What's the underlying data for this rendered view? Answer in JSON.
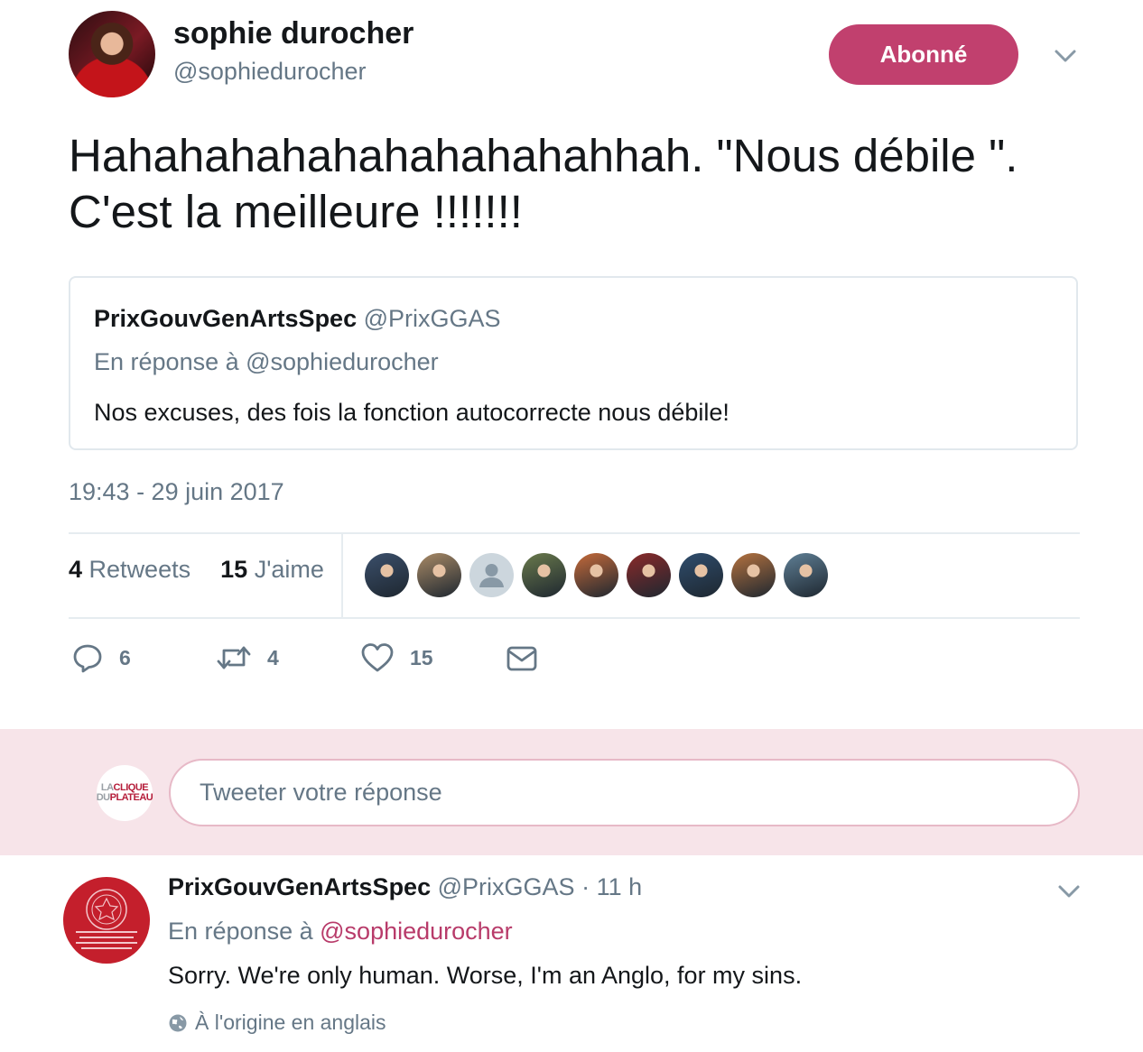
{
  "tweet": {
    "author_name": "sophie durocher",
    "author_handle": "@sophiedurocher",
    "follow_label": "Abonné",
    "text": "Hahahahahahahahahahahhah. \"Nous débile \". C'est la meilleure !!!!!!!",
    "timestamp": "19:43 - 29 juin 2017",
    "retweets_count": "4",
    "retweets_label": "Retweets",
    "likes_count": "15",
    "likes_label": "J'aime",
    "actions": {
      "reply_count": "6",
      "retweet_count": "4",
      "like_count": "15"
    }
  },
  "quoted": {
    "name": "PrixGouvGenArtsSpec",
    "handle": "@PrixGGAS",
    "reply_to": "En réponse à @sophiedurocher",
    "text": "Nos excuses, des fois la fonction autocorrecte nous débile!"
  },
  "likers": [
    {
      "icon": "avatar-1",
      "color": "#3b4f6b"
    },
    {
      "icon": "avatar-2",
      "color": "#a98a66"
    },
    {
      "icon": "avatar-default",
      "color": "#ccd6dd"
    },
    {
      "icon": "avatar-4",
      "color": "#6a7a4c"
    },
    {
      "icon": "avatar-5",
      "color": "#c56a3a"
    },
    {
      "icon": "avatar-6",
      "color": "#8b2a2a"
    },
    {
      "icon": "avatar-7",
      "color": "#2f4d6d"
    },
    {
      "icon": "avatar-8",
      "color": "#b5723f"
    },
    {
      "icon": "avatar-9",
      "color": "#5f7f95"
    }
  ],
  "composer": {
    "placeholder": "Tweeter votre réponse",
    "logo_line1_gray": "LA",
    "logo_line1_red": "CLIQUE",
    "logo_line2_gray": "DU",
    "logo_line2_red": "PLATEAU"
  },
  "reply": {
    "name": "PrixGouvGenArtsSpec",
    "handle": "@PrixGGAS",
    "separator": "·",
    "time": "11 h",
    "reply_prefix": "En réponse à",
    "reply_mention": "@sophiedurocher",
    "text": "Sorry. We're only human. Worse, I'm an Anglo, for my sins.",
    "translation_note": "À l'origine en anglais"
  },
  "colors": {
    "accent": "#c1406e",
    "muted": "#657786",
    "reply_band": "#f7e4e9"
  }
}
